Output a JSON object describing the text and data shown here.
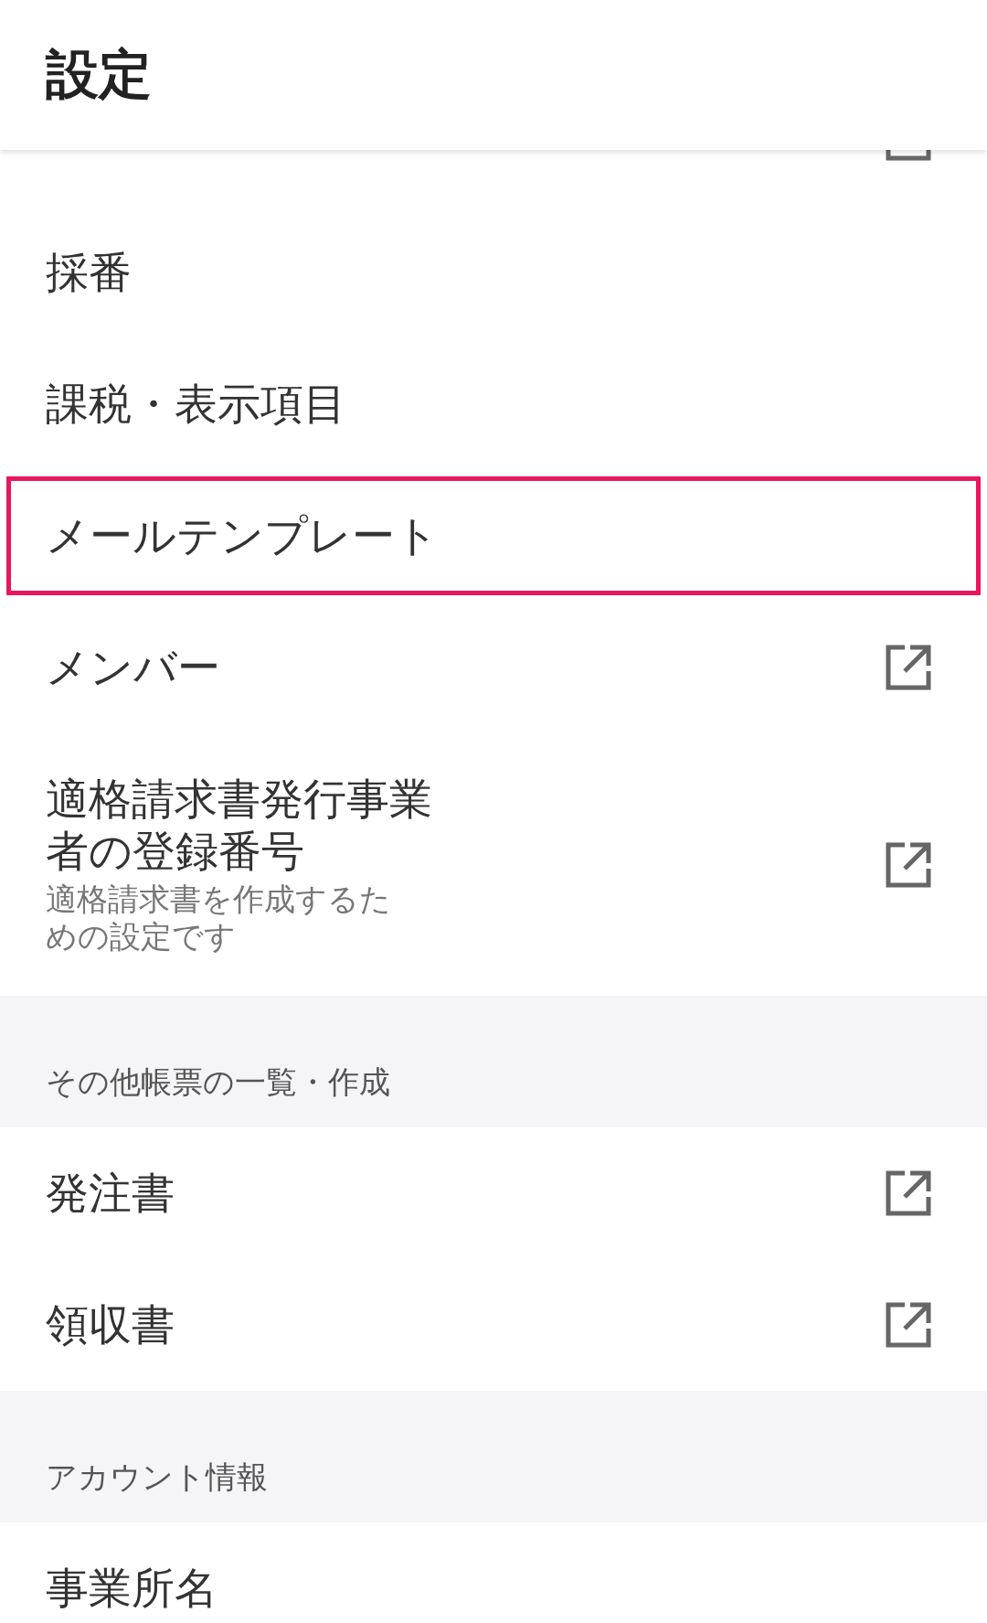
{
  "header": {
    "title": "設定"
  },
  "hidden_row": {
    "external_link": true
  },
  "sections": [
    {
      "items": [
        {
          "label": "採番",
          "external_link": false,
          "highlighted": false
        },
        {
          "label": "課税・表示項目",
          "external_link": false,
          "highlighted": false
        },
        {
          "label": "メールテンプレート",
          "external_link": false,
          "highlighted": true
        },
        {
          "label": "メンバー",
          "external_link": true,
          "highlighted": false
        },
        {
          "label": "適格請求書発行事業者の登録番号",
          "sublabel": "適格請求書を作成するための設定です",
          "external_link": true,
          "highlighted": false
        }
      ]
    },
    {
      "heading": "その他帳票の一覧・作成",
      "items": [
        {
          "label": "発注書",
          "external_link": true,
          "highlighted": false
        },
        {
          "label": "領収書",
          "external_link": true,
          "highlighted": false
        }
      ]
    },
    {
      "heading": "アカウント情報",
      "items": [
        {
          "label": "事業所名",
          "external_link": false,
          "highlighted": false
        }
      ]
    }
  ]
}
